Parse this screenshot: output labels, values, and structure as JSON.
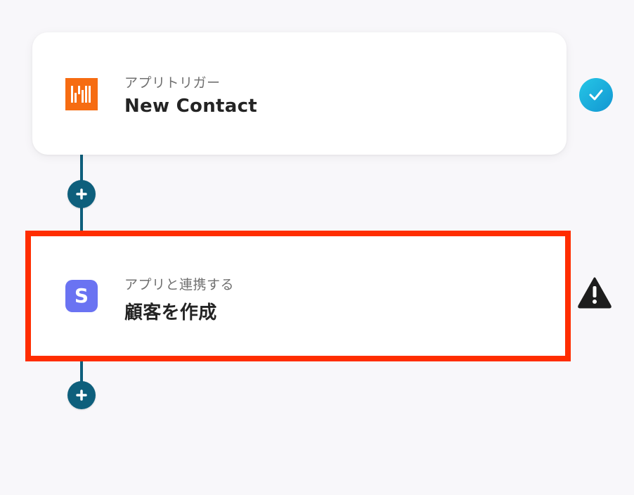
{
  "workflow": {
    "steps": [
      {
        "subtitle": "アプリトリガー",
        "title": "New Contact",
        "app_icon": "highlevel-logo-icon",
        "status_icon": "check-circle-icon",
        "accent_color": "#f66c12"
      },
      {
        "subtitle": "アプリと連携する",
        "title": "顧客を作成",
        "app_icon": "stripe-logo-icon",
        "app_icon_letter": "S",
        "status_icon": "warning-triangle-icon",
        "accent_color": "#6a73f2",
        "highlight_color": "#ff2d00"
      }
    ],
    "connector_color": "#0e5f7c",
    "add_button_icon": "plus-icon"
  }
}
